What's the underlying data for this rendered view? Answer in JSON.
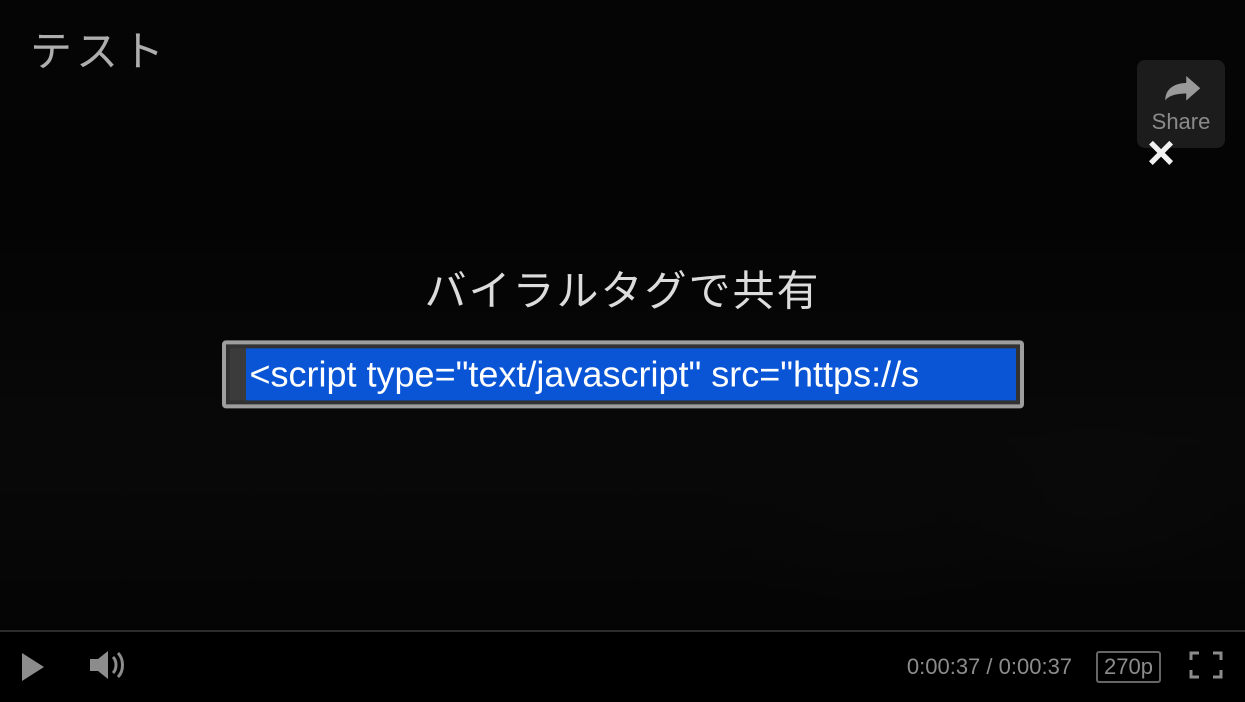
{
  "title": "テスト",
  "share_button": {
    "label": "Share"
  },
  "close_glyph": "×",
  "share_panel": {
    "heading": "バイラルタグで共有",
    "embed_value": "<script type=\"text/javascript\" src=\"https://s"
  },
  "controls": {
    "current_time": "0:00:37",
    "duration": "0:00:37",
    "separator": " / ",
    "quality": "270p"
  }
}
